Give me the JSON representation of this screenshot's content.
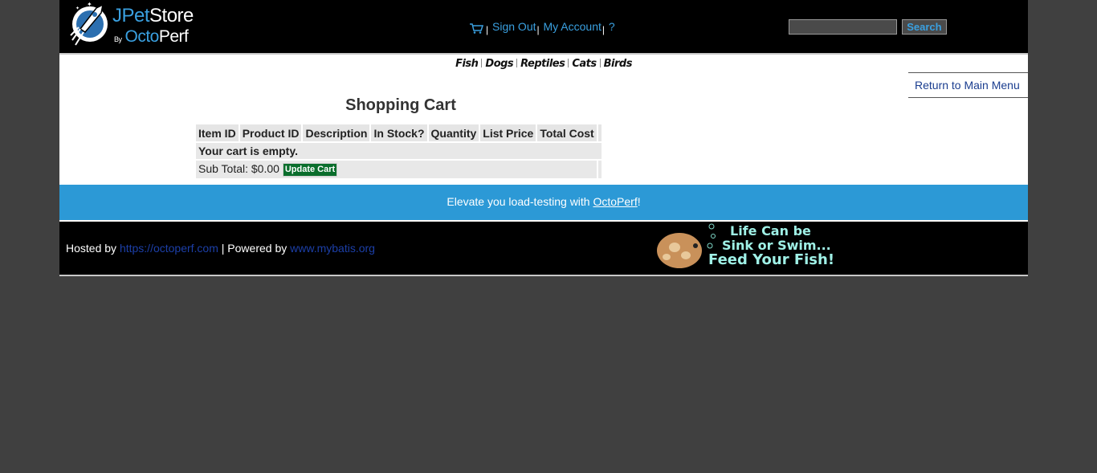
{
  "header": {
    "logo": {
      "brand_a": "J",
      "brand_b": "Pet",
      "brand_c": "Store",
      "by": "By",
      "octo": "Octo",
      "perf": "Perf"
    },
    "menu": {
      "sign_out": "Sign Out",
      "my_account": "My Account",
      "help": "?",
      "separator": "|"
    },
    "search": {
      "button_label": "Search",
      "value": ""
    }
  },
  "quicklinks": [
    "Fish",
    "Dogs",
    "Reptiles",
    "Cats",
    "Birds"
  ],
  "content": {
    "back_link": "Return to Main Menu",
    "title": "Shopping Cart",
    "table": {
      "headers": [
        "Item ID",
        "Product ID",
        "Description",
        "In Stock?",
        "Quantity",
        "List Price",
        "Total Cost"
      ],
      "empty_message": "Your cart is empty.",
      "subtotal_label": "Sub Total: $0.00",
      "update_button": "Update Cart"
    }
  },
  "banner": {
    "prefix": "Elevate you load-testing with ",
    "link": "OctoPerf",
    "suffix": "!"
  },
  "footer": {
    "hosted_by": "Hosted by ",
    "host_link": "https://octoperf.com",
    "powered_by": " | Powered by ",
    "powered_link": "www.mybatis.org",
    "ad_line1": "Life Can be",
    "ad_line2": "Sink or Swim...",
    "ad_line3": "Feed Your Fish!"
  },
  "colors": {
    "accent": "#3aa0e0",
    "banner": "#2c99d6",
    "update_button": "#0a6e2c",
    "background": "#404040"
  }
}
